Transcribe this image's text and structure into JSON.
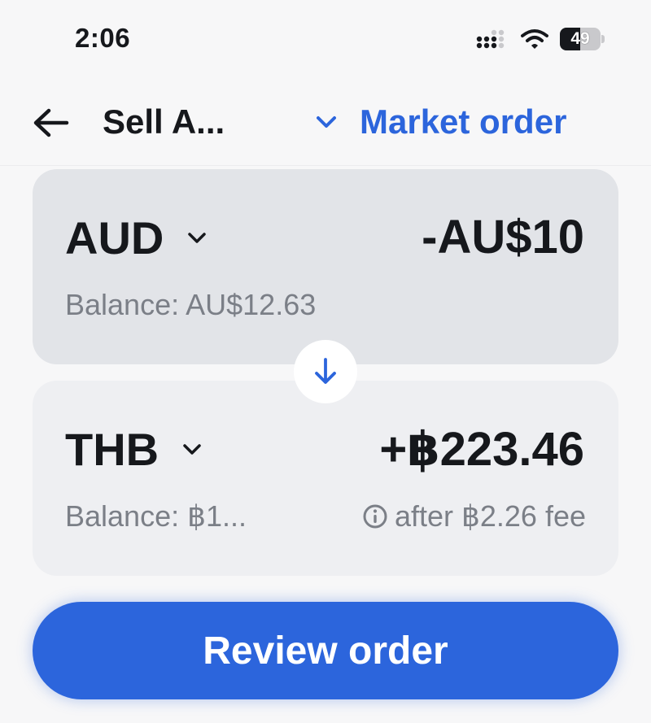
{
  "status_bar": {
    "time": "2:06",
    "battery_level": "49",
    "battery_fraction": 0.49
  },
  "header": {
    "back_icon": "arrow-left-icon",
    "title": "Sell A...",
    "order_type": "Market order",
    "order_type_icon": "chevron-down-icon"
  },
  "from": {
    "currency": "AUD",
    "amount": "-AU$10",
    "balance": "Balance: AU$12.63"
  },
  "swap": {
    "icon": "arrow-down-icon"
  },
  "to": {
    "currency": "THB",
    "amount": "+฿223.46",
    "balance": "Balance: ฿1...",
    "fee_note": "after ฿2.26 fee",
    "fee_icon": "info-icon"
  },
  "actions": {
    "review_label": "Review order"
  },
  "colors": {
    "accent": "#2c65dc",
    "from_card": "#e2e4e8",
    "to_card": "#eeeff2",
    "muted_text": "#7b7f87"
  }
}
